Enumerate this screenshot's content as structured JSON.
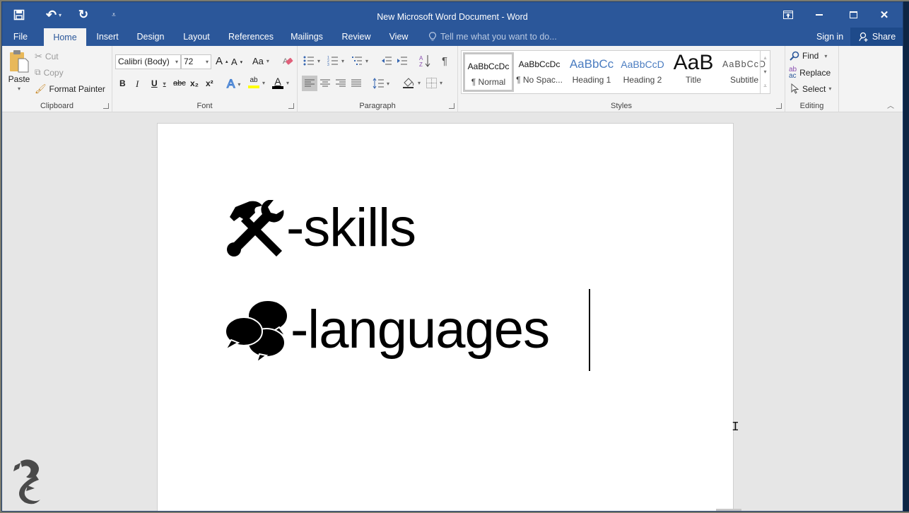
{
  "window": {
    "title": "New Microsoft Word Document - Word",
    "qat": [
      {
        "name": "save-icon",
        "glyph": "💾"
      },
      {
        "name": "undo-icon",
        "glyph": "↶"
      },
      {
        "name": "redo-icon",
        "glyph": "↻"
      },
      {
        "name": "customize-qat-icon",
        "glyph": "⩡"
      }
    ],
    "controls": {
      "ribbon_display": "⊼",
      "minimize": "—",
      "maximize": "☐",
      "close": "✕"
    }
  },
  "tabs": {
    "file": "File",
    "items": [
      "Home",
      "Insert",
      "Design",
      "Layout",
      "References",
      "Mailings",
      "Review",
      "View"
    ],
    "active": "Home",
    "tell_me_placeholder": "Tell me what you want to do...",
    "sign_in": "Sign in",
    "share": "Share"
  },
  "ribbon": {
    "clipboard": {
      "label": "Clipboard",
      "paste": "Paste",
      "cut": "Cut",
      "copy": "Copy",
      "format_painter": "Format Painter"
    },
    "font": {
      "label": "Font",
      "font_name": "Calibri (Body)",
      "font_size": "72",
      "grow": "A",
      "shrink": "A",
      "change_case": "Aa",
      "bold": "B",
      "italic": "I",
      "underline": "U",
      "strikethrough": "abc",
      "subscript": "x₂",
      "superscript": "x²",
      "text_effects": "A",
      "highlight": "ab",
      "font_color": "A",
      "highlight_color": "#ffff00",
      "font_color_value": "#000000"
    },
    "paragraph": {
      "label": "Paragraph",
      "pilcrow": "¶",
      "sort": "A↓"
    },
    "styles": {
      "label": "Styles",
      "items": [
        {
          "preview": "AaBbCcDc",
          "name": "¶ Normal",
          "selected": true
        },
        {
          "preview": "AaBbCcDc",
          "name": "¶ No Spac..."
        },
        {
          "preview": "AaBbCc",
          "name": "Heading 1"
        },
        {
          "preview": "AaBbCcD",
          "name": "Heading 2"
        },
        {
          "preview": "AaB",
          "name": "Title"
        },
        {
          "preview": "AaBbCcD",
          "name": "Subtitle"
        }
      ]
    },
    "editing": {
      "label": "Editing",
      "find": "Find",
      "replace": "Replace",
      "select": "Select"
    }
  },
  "document": {
    "lines": [
      {
        "icon": "hammer-wrench-icon",
        "text": "-skills"
      },
      {
        "icon": "speech-bubbles-icon",
        "text": "-languages"
      }
    ]
  }
}
